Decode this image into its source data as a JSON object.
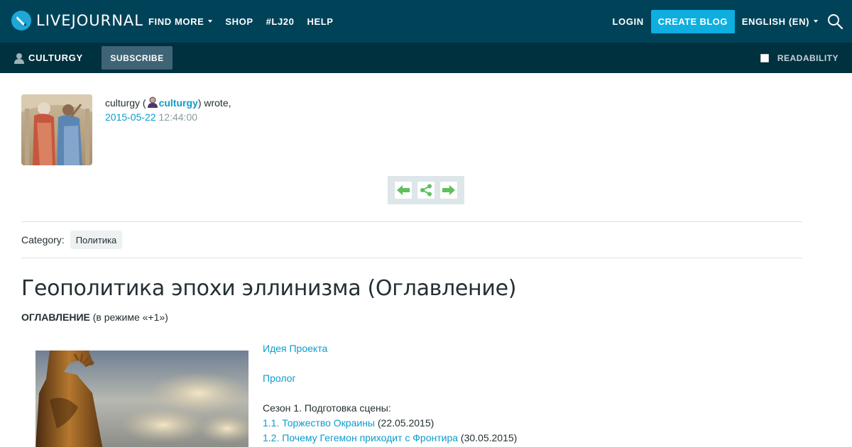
{
  "topbar": {
    "logo_text": "LIVEJOURNAL",
    "nav": [
      {
        "label": "FIND MORE",
        "has_caret": true
      },
      {
        "label": "SHOP",
        "has_caret": false
      },
      {
        "label": "#LJ20",
        "has_caret": false
      },
      {
        "label": "HELP",
        "has_caret": false
      }
    ],
    "login_label": "LOGIN",
    "create_blog_label": "CREATE BLOG",
    "language_label": "ENGLISH (EN)",
    "search_icon": "search-icon"
  },
  "subbar": {
    "journal_name": "CULTURGY",
    "subscribe_label": "SUBSCRIBE",
    "readability_label": "READABILITY"
  },
  "post": {
    "author_prefix": "culturgy (",
    "author_username": "culturgy",
    "author_suffix": ") wrote,",
    "date": "2015-05-22",
    "time": "12:44:00",
    "category_label": "Category:",
    "category_tag": "Политика",
    "title": "Геополитика эпохи эллинизма (Оглавление)",
    "toc_bold": "ОГЛАВЛЕНИЕ",
    "toc_rest": " (в режиме «+1»)",
    "links": {
      "idea": "Идея Проекта",
      "prologue": "Пролог",
      "season1": "Сезон 1. Подготовка сцены:",
      "ep1_link": "1.1. Торжество Окраины",
      "ep1_date": " (22.05.2015)",
      "ep2_link": "1.2. Почему Гегемон приходит с Фронтира",
      "ep2_date": " (30.05.2015)"
    }
  },
  "colors": {
    "topbar": "#004359",
    "subbar": "#00313f",
    "accent": "#0eaee0",
    "link": "#0c9ccc",
    "arrow_green": "#5fbf5f"
  }
}
